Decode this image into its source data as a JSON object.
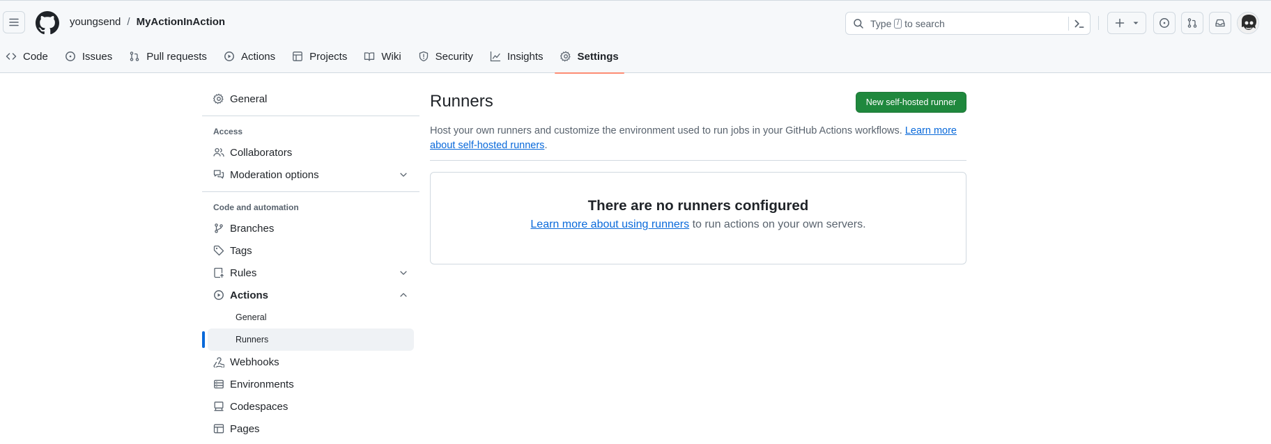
{
  "header": {
    "owner": "youngsend",
    "separator": "/",
    "repo": "MyActionInAction",
    "search_prefix": "Type",
    "search_key": "/",
    "search_suffix": "to search"
  },
  "tabs": [
    {
      "label": "Code",
      "icon": "code-icon"
    },
    {
      "label": "Issues",
      "icon": "issue-icon"
    },
    {
      "label": "Pull requests",
      "icon": "pull-request-icon"
    },
    {
      "label": "Actions",
      "icon": "play-icon"
    },
    {
      "label": "Projects",
      "icon": "table-icon"
    },
    {
      "label": "Wiki",
      "icon": "book-icon"
    },
    {
      "label": "Security",
      "icon": "shield-icon"
    },
    {
      "label": "Insights",
      "icon": "graph-icon"
    },
    {
      "label": "Settings",
      "icon": "gear-icon",
      "active": true
    }
  ],
  "sidebar": {
    "general": "General",
    "access_heading": "Access",
    "collaborators": "Collaborators",
    "moderation": "Moderation options",
    "code_heading": "Code and automation",
    "branches": "Branches",
    "tags": "Tags",
    "rules": "Rules",
    "actions": "Actions",
    "actions_general": "General",
    "actions_runners": "Runners",
    "webhooks": "Webhooks",
    "environments": "Environments",
    "codespaces": "Codespaces",
    "pages": "Pages"
  },
  "main": {
    "title": "Runners",
    "new_runner_button": "New self-hosted runner",
    "description": "Host your own runners and customize the environment used to run jobs in your GitHub Actions workflows.",
    "learn_more_link": "Learn more about self-hosted runners",
    "description_end": ".",
    "blank_title": "There are no runners configured",
    "blank_link": "Learn more about using runners",
    "blank_text": "to run actions on your own servers."
  },
  "colors": {
    "primary_button": "#1f883d",
    "link": "#0969da",
    "active_tab_underline": "#fd8c73",
    "selected_bar": "#0969da"
  }
}
